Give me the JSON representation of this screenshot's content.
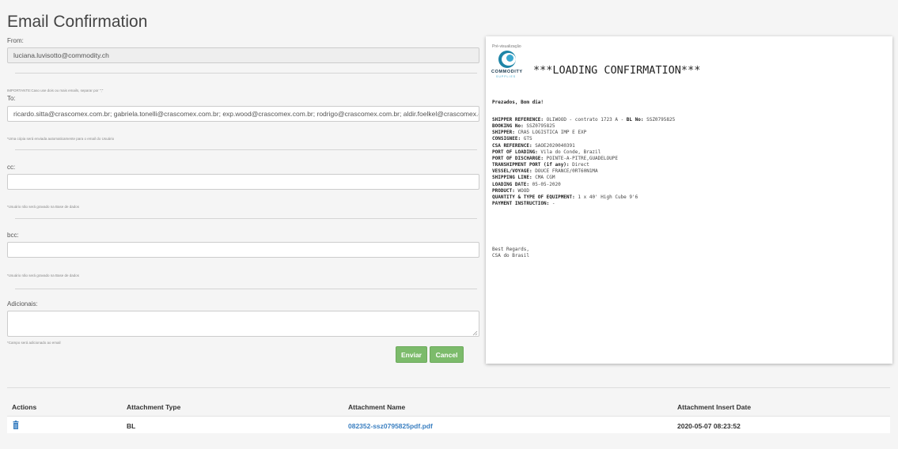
{
  "page": {
    "title": "Email Confirmation"
  },
  "form": {
    "from_label": "From:",
    "from_value": "luciana.luvisotto@commodity.ch",
    "important_note": "IMPORTANTE:Caso use dois ou mais emails, separar por \";\"",
    "to_label": "To:",
    "to_value": "ricardo.sitta@crascomex.com.br; gabriela.tonelli@crascomex.com.br; exp.wood@crascomex.com.br; rodrigo@crascomex.com.br; aldir.foelkel@crascomex.com.br",
    "to_note": "*Uma cópia será enviada automaticamente para o email do Usuário",
    "cc_label": "cc:",
    "cc_value": "",
    "cc_note": "*Usuário não será gravado na Base de dados",
    "bcc_label": "bcc:",
    "bcc_value": "",
    "bcc_note": "*Usuário não será gravado na Base de dados",
    "extra_label": "Adicionais:",
    "extra_value": "",
    "extra_note": "*Campo será adicionado ao email",
    "send_label": "Enviar",
    "cancel_label": "Cancel"
  },
  "preview": {
    "label": "Pré-visualização",
    "logo_text": "COMMODITY",
    "logo_sub": "SUPPLIES",
    "heading": "***LOADING CONFIRMATION***",
    "greeting": "Prezados, Bom dia!",
    "lines": [
      {
        "key": "SHIPPER REFERENCE:",
        "value": " OLIWOOD - contrato 1723 A - ",
        "key2": "BL No:",
        "value2": " SSZ0795825"
      },
      {
        "key": "BOOKING No:",
        "value": " SSZ0795825"
      },
      {
        "key": "SHIPPER:",
        "value": " CRAS LOGISTICA IMP E EXP"
      },
      {
        "key": "CONSIGNEE:",
        "value": " GTS"
      },
      {
        "key": "CSA REFERENCE:",
        "value": " SAOE2020040391"
      },
      {
        "key": "PORT OF LOADING:",
        "value": " Vila do Conde, Brazil"
      },
      {
        "key": "PORT OF DISCHARGE:",
        "value": " POINTE-A-PITRE,GUADELOUPE"
      },
      {
        "key": "TRANSHIPMENT PORT (if any):",
        "value": " Direct"
      },
      {
        "key": "VESSEL/VOYAGE:",
        "value": " DOUCE FRANCE/0RT60N1MA"
      },
      {
        "key": "SHIPPING LINE:",
        "value": " CMA CGM"
      },
      {
        "key": "LOADING DATE:",
        "value": " 05-05-2020"
      },
      {
        "key": "PRODUCT:",
        "value": " WOOD"
      },
      {
        "key": "QUANTITY & TYPE OF EQUIPMENT:",
        "value": " 1 x 40' High Cube 9'6"
      },
      {
        "key": "PAYMENT INSTRUCTION:",
        "value": " -"
      }
    ],
    "regards": "Best Regards,",
    "signature": "CSA do Brasil"
  },
  "table": {
    "headers": [
      "Actions",
      "Attachment Type",
      "Attachment Name",
      "Attachment Insert Date"
    ],
    "rows": [
      {
        "type": "BL",
        "name": "082352-ssz0795825pdf.pdf",
        "date": "2020-05-07 08:23:52"
      }
    ]
  },
  "colors": {
    "accent_green": "#7cbb6b",
    "link_blue": "#3a7fc1"
  }
}
